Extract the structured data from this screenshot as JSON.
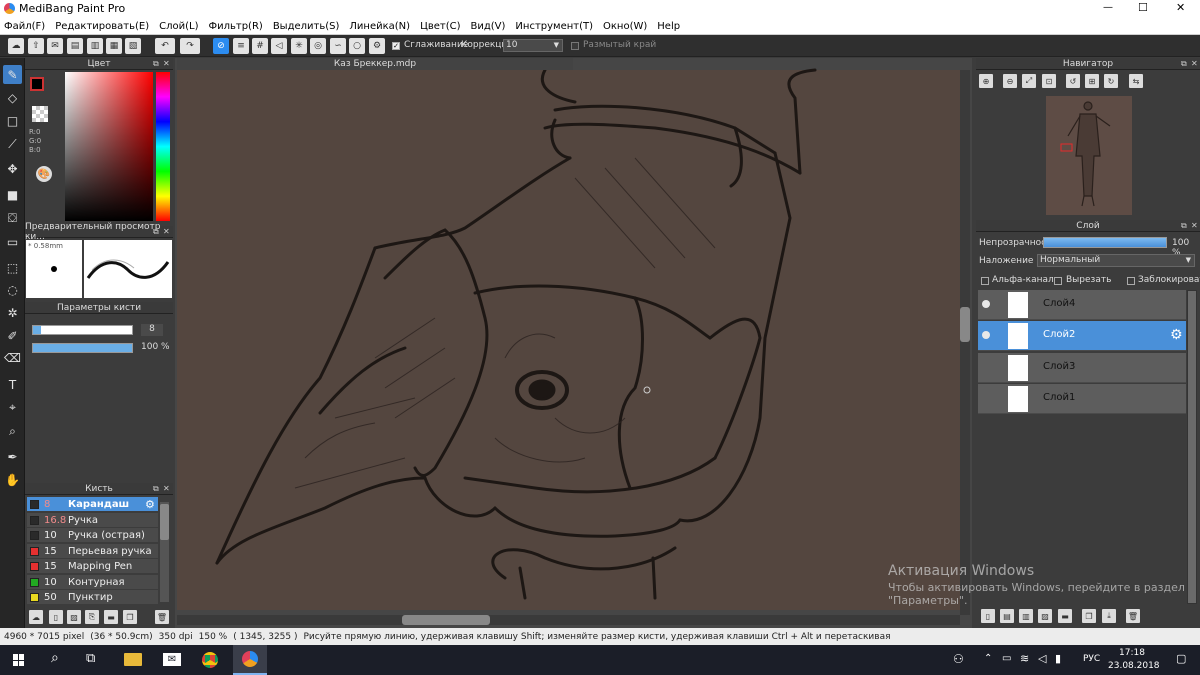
{
  "app": {
    "title": "MediBang Paint Pro",
    "window_controls": {
      "minimize": "—",
      "maximize": "☐",
      "close": "✕"
    }
  },
  "menu": [
    "Файл(F)",
    "Редактировать(E)",
    "Слой(L)",
    "Фильтр(R)",
    "Выделить(S)",
    "Линейка(N)",
    "Цвет(C)",
    "Вид(V)",
    "Инструмент(T)",
    "Окно(W)",
    "Help"
  ],
  "toolbar": {
    "smoothing_label": "Сглаживание",
    "correction_label": "Коррекция",
    "correction_value": "10",
    "blur_edge_label": "Размытый край"
  },
  "color_panel": {
    "title": "Цвет",
    "r": "R:0",
    "g": "G:0",
    "b": "B:0",
    "primary_color": "#000000",
    "secondary_color": "#e8a0b4"
  },
  "brush_preview": {
    "title": "Предварительный просмотр ки...",
    "size": "0.58mm"
  },
  "brush_params": {
    "title": "Параметры кисти",
    "size_value": "8",
    "opacity_value": "100 %",
    "size_fraction": 0.08,
    "opacity_fraction": 1.0
  },
  "brush_list": {
    "title": "Кисть",
    "items": [
      {
        "size": "8",
        "name": "Карандаш",
        "color": "#2a2a2a",
        "selected": true
      },
      {
        "size": "16.8",
        "name": "Ручка",
        "color": "#2a2a2a",
        "selected": false
      },
      {
        "size": "10",
        "name": "Ручка (острая)",
        "color": "#2a2a2a",
        "selected": false
      },
      {
        "size": "15",
        "name": "Перьевая ручка",
        "color": "#e53030",
        "selected": false
      },
      {
        "size": "15",
        "name": "Mapping Pen",
        "color": "#e53030",
        "selected": false
      },
      {
        "size": "10",
        "name": "Контурная ручка",
        "color": "#22aa22",
        "selected": false
      },
      {
        "size": "50",
        "name": "Пунктир",
        "color": "#e8d820",
        "selected": false
      }
    ]
  },
  "canvas": {
    "tab_title": "Каз Бреккер.mdp"
  },
  "navigator": {
    "title": "Навигатор"
  },
  "layers": {
    "title": "Слой",
    "opacity_label": "Непрозрачность",
    "opacity_value": "100 %",
    "opacity_fraction": 1.0,
    "blend_label": "Наложение",
    "blend_value": "Нормальный",
    "alpha_label": "Альфа-канал",
    "clip_label": "Вырезать",
    "lock_label": "Заблокировать",
    "items": [
      {
        "name": "Слой4",
        "visible": true,
        "selected": false
      },
      {
        "name": "Слой2",
        "visible": true,
        "selected": true
      },
      {
        "name": "Слой3",
        "visible": false,
        "selected": false
      },
      {
        "name": "Слой1",
        "visible": false,
        "selected": false
      }
    ]
  },
  "watermark": {
    "title": "Активация Windows",
    "line1": "Чтобы активировать Windows, перейдите в раздел",
    "line2": "\"Параметры\"."
  },
  "status": {
    "size": "4960 * 7015 pixel",
    "cm": "(36 * 50.9cm)",
    "dpi": "350 dpi",
    "zoom": "150 %",
    "coords": "( 1345, 3255 )",
    "hint": "Рисуйте прямую линию, удерживая клавишу Shift; изменяйте размер кисти, удерживая клавиши Ctrl + Alt и перетаскивая"
  },
  "taskbar": {
    "lang": "РУС",
    "time": "17:18",
    "date": "23.08.2018"
  },
  "colors": {
    "accent": "#4a90d9",
    "canvas_bg": "#54463f",
    "panel_bg": "#3c3c3c"
  }
}
